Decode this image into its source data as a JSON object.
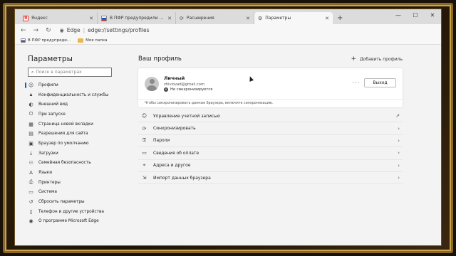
{
  "tabs": [
    {
      "label": "Яндекс",
      "icon": "yandex-icon"
    },
    {
      "label": "В ПФР предупредили о новой",
      "icon": "pfr-flag-icon"
    },
    {
      "label": "Расширения",
      "icon": "extensions-icon"
    },
    {
      "label": "Параметры",
      "icon": "gear-icon",
      "active": true
    }
  ],
  "address": {
    "site": "Edge",
    "separator": "|",
    "url": "edge://settings/profiles"
  },
  "bookmarks": [
    {
      "label": "В ПФР предупреди...",
      "icon": "pfr-flag-icon"
    },
    {
      "label": "Моя папка",
      "icon": "folder-icon"
    }
  ],
  "sidebar": {
    "title": "Параметры",
    "search_placeholder": "Поиск в параметрах",
    "items": [
      {
        "label": "Профили",
        "icon": "profile-icon",
        "active": true
      },
      {
        "label": "Конфиденциальность и службы",
        "icon": "lock-icon"
      },
      {
        "label": "Внешний вид",
        "icon": "appearance-icon"
      },
      {
        "label": "При запуске",
        "icon": "power-icon"
      },
      {
        "label": "Страница новой вкладки",
        "icon": "new-tab-icon"
      },
      {
        "label": "Разрешения для сайта",
        "icon": "site-permissions-icon"
      },
      {
        "label": "Браузер по умолчанию",
        "icon": "default-browser-icon"
      },
      {
        "label": "Загрузки",
        "icon": "download-icon"
      },
      {
        "label": "Семейная безопасность",
        "icon": "family-icon"
      },
      {
        "label": "Языки",
        "icon": "languages-icon"
      },
      {
        "label": "Принтеры",
        "icon": "printer-icon"
      },
      {
        "label": "Система",
        "icon": "system-icon"
      },
      {
        "label": "Сбросить параметры",
        "icon": "reset-icon"
      },
      {
        "label": "Телефон и другие устройства",
        "icon": "phone-icon"
      },
      {
        "label": "О программе Microsoft Edge",
        "icon": "edge-logo-icon"
      }
    ]
  },
  "main": {
    "title": "Ваш профиль",
    "add_profile": "Добавить профиль",
    "profile": {
      "name": "Личный",
      "email": "zhivlovad@gmail.com",
      "sync_status": "Не синхронизируется",
      "more": "···",
      "logout": "Выход",
      "note": "Чтобы синхронизировать данные браузера, включите синхронизацию."
    },
    "rows": [
      {
        "label": "Управление учетной записью",
        "icon": "account-icon",
        "trailing": "external-link-icon"
      },
      {
        "label": "Синхронизировать",
        "icon": "sync-icon",
        "trailing": "chevron-right-icon"
      },
      {
        "label": "Пароли",
        "icon": "key-icon",
        "trailing": "chevron-right-icon"
      },
      {
        "label": "Сведения об оплате",
        "icon": "card-icon",
        "trailing": "chevron-right-icon"
      },
      {
        "label": "Адреса и другое",
        "icon": "location-icon",
        "trailing": "chevron-right-icon"
      },
      {
        "label": "Импорт данных браузера",
        "icon": "import-icon",
        "trailing": "chevron-right-icon"
      }
    ]
  }
}
